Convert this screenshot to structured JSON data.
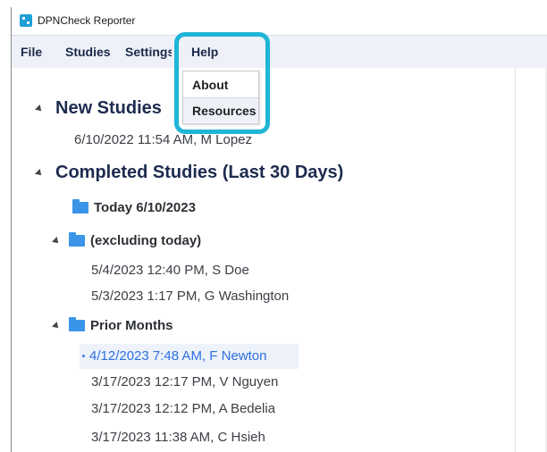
{
  "window": {
    "title": "DPNCheck Reporter"
  },
  "menu": {
    "file": "File",
    "studies": "Studies",
    "settings": "Settings",
    "help": "Help"
  },
  "help_menu": {
    "about": "About",
    "resources": "Resources"
  },
  "tree": {
    "new_studies": {
      "label": "New Studies",
      "items": [
        "6/10/2022 11:54 AM, M Lopez"
      ]
    },
    "completed": {
      "label": "Completed Studies (Last 30 Days)",
      "today": "Today 6/10/2023",
      "excluding": {
        "label": "(excluding today)",
        "items": [
          "5/4/2023 12:40 PM, S Doe",
          "5/3/2023 1:17 PM, G Washington"
        ]
      },
      "prior": {
        "label": "Prior Months",
        "items": [
          "4/12/2023 7:48 AM, F Newton",
          "3/17/2023 12:17 PM, V Nguyen",
          "3/17/2023 12:12 PM, A Bedelia",
          "3/17/2023 11:38 AM, C Hsieh"
        ]
      }
    }
  },
  "colors": {
    "highlight": "#1fb5d6",
    "selection_text": "#2e6fe0",
    "folder": "#3a95e8"
  }
}
